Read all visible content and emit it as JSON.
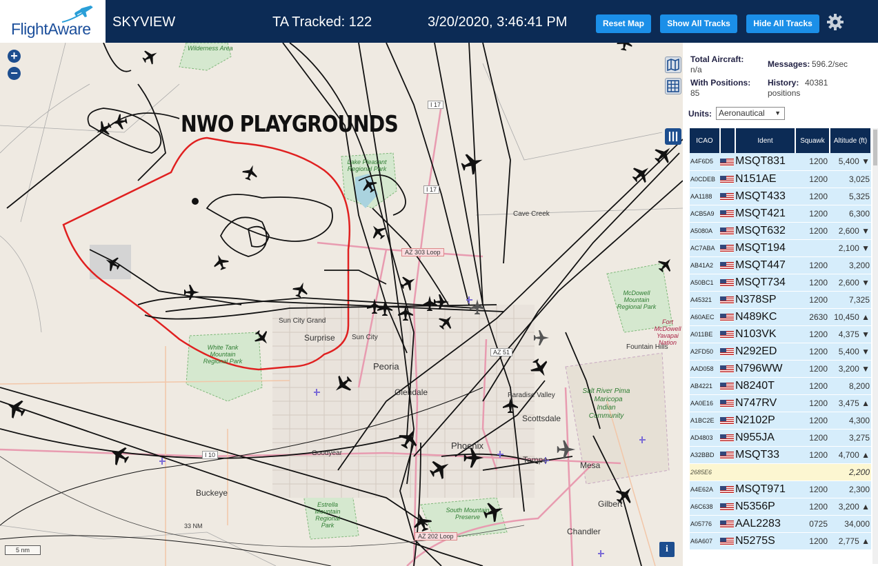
{
  "header": {
    "logo_text": "FlightAware",
    "app_title": "SKYVIEW",
    "ta_tracked": "TA Tracked: 122",
    "clock": "3/20/2020, 3:46:41 PM",
    "reset_btn": "Reset Map",
    "show_btn": "Show All Tracks",
    "hide_btn": "Hide All Tracks",
    "brand_color": "#0c2b55",
    "button_color": "#1b8fe8"
  },
  "map": {
    "annotation": "NWO PLAYGROUNDS",
    "scale_label": "5 nm",
    "range_label": "33 NM",
    "zoom_in": "+",
    "zoom_out": "−",
    "info_icon": "i",
    "places": [
      "Wilderness Area",
      "Cave Creek",
      "Sun City Grand",
      "Surprise",
      "Sun City",
      "Peoria",
      "Glendale",
      "Paradise Valley",
      "Scottsdale",
      "Phoenix",
      "Tempe",
      "Mesa",
      "Gilbert",
      "Chandler",
      "Goodyear",
      "Buckeye",
      "Fountain Hills"
    ],
    "parks": [
      "Lake Pleasant Regional Park",
      "White Tank Mountain Regional Park",
      "McDowell Mountain Regional Park",
      "Salt River Pima - Maricopa Indian Community",
      "Estrella Mountain Regional Park",
      "South Mountain Preserve",
      "Fort McDowell Yavapai Nation"
    ],
    "roads": [
      "I 17",
      "I 17",
      "AZ 303 Loop",
      "AZ 51",
      "I 10",
      "AZ 202 Loop"
    ],
    "track_color": "#111111",
    "annotation_color": "#e02020"
  },
  "stats": {
    "total_label": "Total Aircraft:",
    "total_value": "n/a",
    "positions_label": "With Positions:",
    "positions_value": "85",
    "messages_label": "Messages:",
    "messages_value": "596.2/sec",
    "history_label": "History:",
    "history_value": "40381 positions",
    "units_label": "Units:",
    "units_value": "Aeronautical"
  },
  "table": {
    "headers": [
      "ICAO",
      "Ident",
      "Squawk",
      "Altitude (ft)"
    ],
    "rows": [
      {
        "icao": "A4F6D5",
        "ident": "MSQT831",
        "squawk": "1200",
        "alt": "5,400 ▼"
      },
      {
        "icao": "A0CDEB",
        "ident": "N151AE",
        "squawk": "1200",
        "alt": "3,025"
      },
      {
        "icao": "AA1188",
        "ident": "MSQT433",
        "squawk": "1200",
        "alt": "5,325"
      },
      {
        "icao": "ACB5A9",
        "ident": "MSQT421",
        "squawk": "1200",
        "alt": "6,300"
      },
      {
        "icao": "A5080A",
        "ident": "MSQT632",
        "squawk": "1200",
        "alt": "2,600 ▼"
      },
      {
        "icao": "AC7ABA",
        "ident": "MSQT194",
        "squawk": "",
        "alt": "2,100 ▼"
      },
      {
        "icao": "AB41A2",
        "ident": "MSQT447",
        "squawk": "1200",
        "alt": "3,200"
      },
      {
        "icao": "A50BC1",
        "ident": "MSQT734",
        "squawk": "1200",
        "alt": "2,600 ▼"
      },
      {
        "icao": "A45321",
        "ident": "N378SP",
        "squawk": "1200",
        "alt": "7,325"
      },
      {
        "icao": "A60AEC",
        "ident": "N489KC",
        "squawk": "2630",
        "alt": "10,450 ▲"
      },
      {
        "icao": "A011BE",
        "ident": "N103VK",
        "squawk": "1200",
        "alt": "4,375 ▼"
      },
      {
        "icao": "A2FD50",
        "ident": "N292ED",
        "squawk": "1200",
        "alt": "5,400 ▼"
      },
      {
        "icao": "AAD058",
        "ident": "N796WW",
        "squawk": "1200",
        "alt": "3,200 ▼"
      },
      {
        "icao": "AB4221",
        "ident": "N8240T",
        "squawk": "1200",
        "alt": "8,200"
      },
      {
        "icao": "AA0E16",
        "ident": "N747RV",
        "squawk": "1200",
        "alt": "3,475 ▲"
      },
      {
        "icao": "A1BC2E",
        "ident": "N2102P",
        "squawk": "1200",
        "alt": "4,300"
      },
      {
        "icao": "AD4803",
        "ident": "N955JA",
        "squawk": "1200",
        "alt": "3,275"
      },
      {
        "icao": "A32BBD",
        "ident": "MSQT33",
        "squawk": "1200",
        "alt": "4,700 ▲"
      },
      {
        "icao": "2685E6",
        "ident": "",
        "squawk": "",
        "alt": "2,200",
        "highlight": true
      },
      {
        "icao": "A4E62A",
        "ident": "MSQT971",
        "squawk": "1200",
        "alt": "2,300"
      },
      {
        "icao": "A6C638",
        "ident": "N5356P",
        "squawk": "1200",
        "alt": "3,200 ▲"
      },
      {
        "icao": "A05776",
        "ident": "AAL2283",
        "squawk": "0725",
        "alt": "34,000"
      },
      {
        "icao": "A6A607",
        "ident": "N5275S",
        "squawk": "1200",
        "alt": "2,775 ▲"
      }
    ]
  }
}
